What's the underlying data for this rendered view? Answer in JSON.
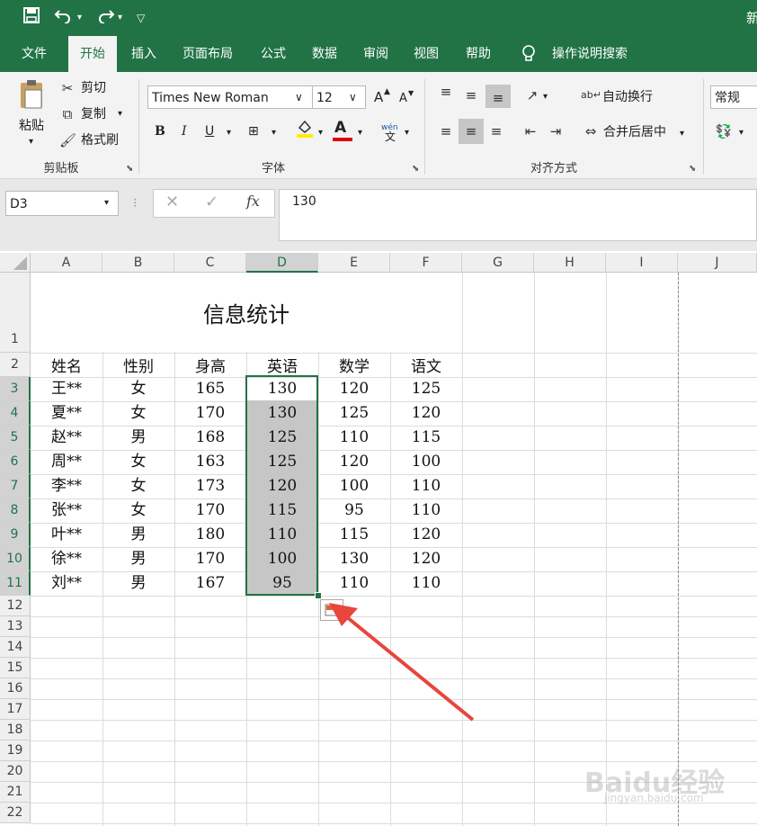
{
  "app": {
    "title_fragment": "新"
  },
  "tabs": [
    "文件",
    "开始",
    "插入",
    "页面布局",
    "公式",
    "数据",
    "审阅",
    "视图",
    "帮助"
  ],
  "active_tab": "开始",
  "tell_me": "操作说明搜索",
  "clipboard": {
    "paste": "粘贴",
    "cut": "剪切",
    "copy": "复制",
    "format_painter": "格式刷",
    "label": "剪贴板"
  },
  "font": {
    "name": "Times New Roman",
    "size": "12",
    "label": "字体",
    "bold": "B",
    "italic": "I",
    "underline": "U",
    "font_color_letter": "A",
    "grow": "A",
    "shrink": "A",
    "pinyin": "wén"
  },
  "alignment": {
    "wrap": "自动换行",
    "merge": "合并后居中",
    "label": "对齐方式"
  },
  "number": {
    "format": "常规"
  },
  "formula_bar": {
    "name_box": "D3",
    "fx": "fx",
    "value": "130"
  },
  "columns": [
    "A",
    "B",
    "C",
    "D",
    "E",
    "F",
    "G",
    "H",
    "I",
    "J"
  ],
  "rows": [
    "1",
    "2",
    "3",
    "4",
    "5",
    "6",
    "7",
    "8",
    "9",
    "10",
    "11",
    "12",
    "13",
    "14",
    "15",
    "16",
    "17",
    "18",
    "19",
    "20",
    "21",
    "22"
  ],
  "sheet": {
    "title": "信息统计",
    "headers": [
      "姓名",
      "性别",
      "身高",
      "英语",
      "数学",
      "语文"
    ],
    "data": [
      [
        "王**",
        "女",
        "165",
        "130",
        "120",
        "125"
      ],
      [
        "夏**",
        "女",
        "170",
        "130",
        "125",
        "120"
      ],
      [
        "赵**",
        "男",
        "168",
        "125",
        "110",
        "115"
      ],
      [
        "周**",
        "女",
        "163",
        "125",
        "120",
        "100"
      ],
      [
        "李**",
        "女",
        "173",
        "120",
        "100",
        "110"
      ],
      [
        "张**",
        "女",
        "170",
        "115",
        "95",
        "110"
      ],
      [
        "叶**",
        "男",
        "180",
        "110",
        "115",
        "120"
      ],
      [
        "徐**",
        "男",
        "170",
        "100",
        "130",
        "120"
      ],
      [
        "刘**",
        "男",
        "167",
        "95",
        "110",
        "110"
      ]
    ]
  },
  "colors": {
    "excel_green": "#217346",
    "selection": "#c6c6c6",
    "arrow": "#e8453c"
  },
  "watermark": {
    "text": "Baidu经验",
    "sub": "jingyan.baidu.com"
  }
}
